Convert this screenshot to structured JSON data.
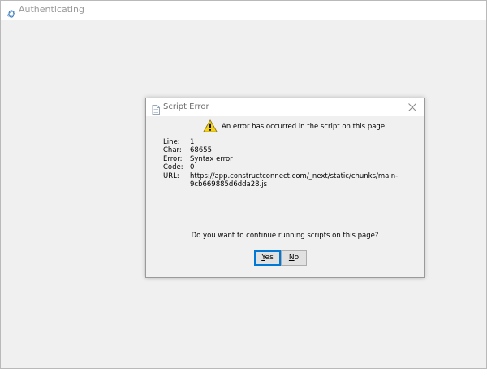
{
  "window": {
    "title": "Authenticating"
  },
  "dialog": {
    "title": "Script Error",
    "message": "An error has occurred in the script on this page.",
    "details": [
      {
        "key": "Line:",
        "value": "1"
      },
      {
        "key": "Char:",
        "value": "68655"
      },
      {
        "key": "Error:",
        "value": "Syntax error"
      },
      {
        "key": "Code:",
        "value": "0"
      },
      {
        "key": "URL:",
        "value": "https://app.constructconnect.com/_next/static/chunks/main-9cb669885d6dda28.js"
      }
    ],
    "question": "Do you want to continue running scripts on this page?",
    "buttons": {
      "yes": {
        "mnemonic": "Y",
        "rest": "es"
      },
      "no": {
        "mnemonic": "N",
        "rest": "o"
      }
    }
  },
  "icons": {
    "app": "browser-app-icon",
    "dialog": "document-icon",
    "close": "close-icon",
    "warning": "warning-icon"
  },
  "colors": {
    "window_background": "#f0f0f0",
    "button_focus_border": "#0078d7",
    "warning_fill": "#f5d31c"
  }
}
